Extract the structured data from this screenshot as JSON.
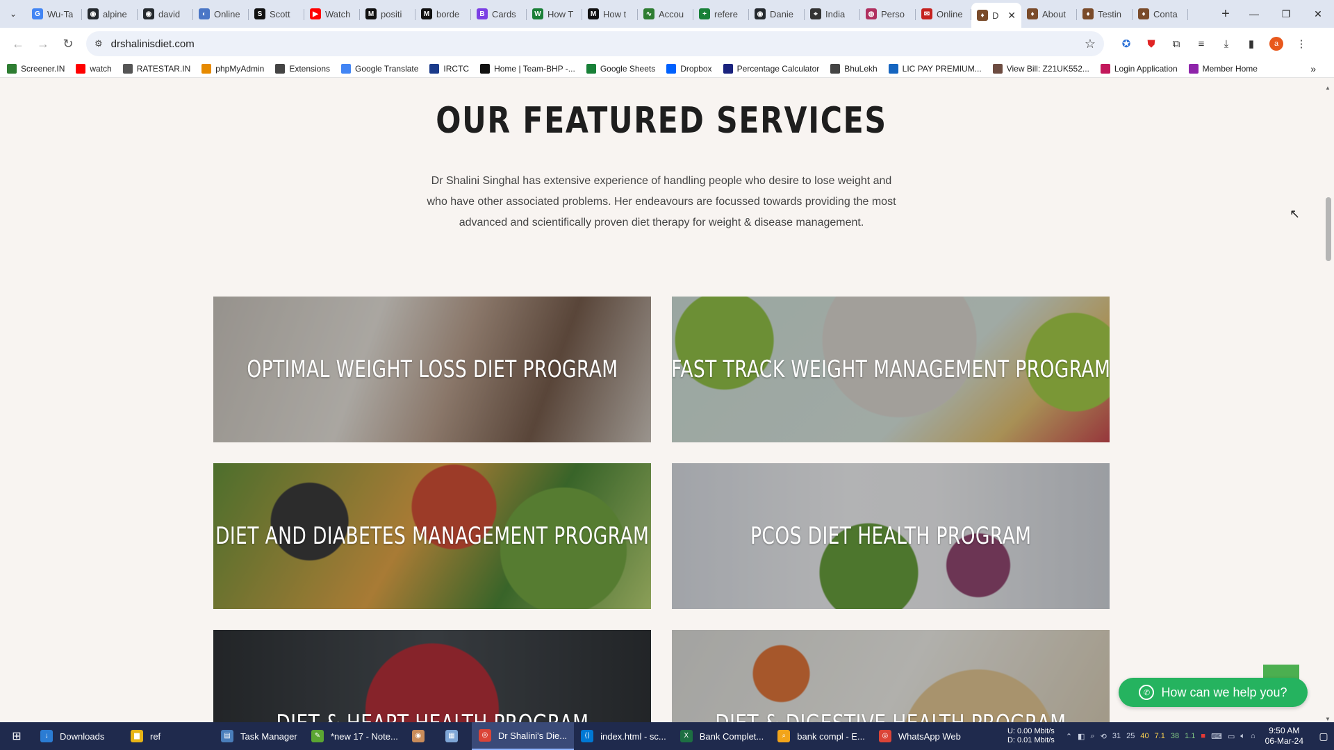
{
  "browser": {
    "tabs": [
      {
        "title": "Wu-Ta",
        "color": "#4285f4",
        "glyph": "G"
      },
      {
        "title": "alpine",
        "color": "#24292e",
        "glyph": "◉"
      },
      {
        "title": "david",
        "color": "#24292e",
        "glyph": "◉"
      },
      {
        "title": "Online",
        "color": "#4a76c6",
        "glyph": "◐"
      },
      {
        "title": "Scott",
        "color": "#111111",
        "glyph": "S"
      },
      {
        "title": "Watch",
        "color": "#ff0000",
        "glyph": "▶"
      },
      {
        "title": "positi",
        "color": "#111111",
        "glyph": "M"
      },
      {
        "title": "borde",
        "color": "#111111",
        "glyph": "M"
      },
      {
        "title": "Cards",
        "color": "#7b3fe4",
        "glyph": "B"
      },
      {
        "title": "How T",
        "color": "#1a7f37",
        "glyph": "W"
      },
      {
        "title": "How t",
        "color": "#111111",
        "glyph": "M"
      },
      {
        "title": "Accou",
        "color": "#2e7d32",
        "glyph": "∿"
      },
      {
        "title": "refere",
        "color": "#188038",
        "glyph": "+"
      },
      {
        "title": "Danie",
        "color": "#24292e",
        "glyph": "◉"
      },
      {
        "title": "India",
        "color": "#333333",
        "glyph": "⌖"
      },
      {
        "title": "Perso",
        "color": "#b03060",
        "glyph": "◍"
      },
      {
        "title": "Online",
        "color": "#c5221f",
        "glyph": "✉"
      },
      {
        "title": "D",
        "color": "#7a4b2a",
        "glyph": "♦",
        "active": true
      },
      {
        "title": "About",
        "color": "#7a4b2a",
        "glyph": "♦"
      },
      {
        "title": "Testin",
        "color": "#7a4b2a",
        "glyph": "♦"
      },
      {
        "title": "Conta",
        "color": "#7a4b2a",
        "glyph": "♦"
      }
    ],
    "url": "drshalinisdiet.com",
    "bookmarks": [
      {
        "label": "Screener.IN",
        "color": "#2e7d32"
      },
      {
        "label": "watch",
        "color": "#ff0000"
      },
      {
        "label": "RATESTAR.IN",
        "color": "#555555"
      },
      {
        "label": "phpMyAdmin",
        "color": "#e68a00"
      },
      {
        "label": "Extensions",
        "color": "#444444"
      },
      {
        "label": "Google Translate",
        "color": "#4285f4"
      },
      {
        "label": "IRCTC",
        "color": "#1a3a8a"
      },
      {
        "label": "Home | Team-BHP -...",
        "color": "#111111"
      },
      {
        "label": "Google Sheets",
        "color": "#188038"
      },
      {
        "label": "Dropbox",
        "color": "#0061fe"
      },
      {
        "label": "Percentage Calculator",
        "color": "#1a237e"
      },
      {
        "label": "BhuLekh",
        "color": "#444444"
      },
      {
        "label": "LIC PAY PREMIUM...",
        "color": "#1565c0"
      },
      {
        "label": "View Bill: Z21UK552...",
        "color": "#6d4c41"
      },
      {
        "label": "Login Application",
        "color": "#c2185b"
      },
      {
        "label": "Member Home",
        "color": "#8e24aa"
      }
    ]
  },
  "page": {
    "heading": "OUR FEATURED SERVICES",
    "intro": "Dr Shalini Singhal has extensive experience of handling people who desire to lose weight and who have other associated problems. Her endeavours are focussed towards providing the most advanced and scientifically proven diet therapy for weight & disease management.",
    "services": [
      {
        "label": "OPTIMAL WEIGHT LOSS DIET PROGRAM"
      },
      {
        "label": "FAST TRACK WEIGHT MANAGEMENT PROGRAM"
      },
      {
        "label": "DIET AND DIABETES MANAGEMENT PROGRAM"
      },
      {
        "label": "PCOS DIET HEALTH PROGRAM"
      },
      {
        "label": "DIET & HEART HEALTH PROGRAM"
      },
      {
        "label": "DIET & DIGESTIVE HEALTH PROGRAM"
      }
    ],
    "help_button": "How can we help you?"
  },
  "taskbar": {
    "items": [
      {
        "label": "Downloads",
        "color": "#2b7cd3",
        "glyph": "↓"
      },
      {
        "label": "ref",
        "color": "#e7b416",
        "glyph": "▆"
      },
      {
        "label": "Task Manager",
        "color": "#4a7ebb",
        "glyph": "▤"
      },
      {
        "label": "*new 17 - Note...",
        "color": "#5ba532",
        "glyph": "✎"
      },
      {
        "label": "",
        "color": "#c98c5a",
        "glyph": "◉"
      },
      {
        "label": "",
        "color": "#7fa6d6",
        "glyph": "▦"
      },
      {
        "label": "Dr Shalini's Die...",
        "color": "#db4437",
        "glyph": "◎",
        "active": true
      },
      {
        "label": "index.html - sc...",
        "color": "#0078d4",
        "glyph": "⟨⟩"
      },
      {
        "label": "Bank Complet...",
        "color": "#1d6f42",
        "glyph": "X"
      },
      {
        "label": "bank compl - E...",
        "color": "#f2a41a",
        "glyph": "⌕"
      },
      {
        "label": "WhatsApp Web",
        "color": "#db4437",
        "glyph": "◎"
      }
    ],
    "net_up": "U:",
    "net_down": "D:",
    "net_up_val": "0.00 Mbit/s",
    "net_down_val": "0.01 Mbit/s",
    "tray_values": [
      "31",
      "25",
      "40",
      "7.1",
      "38",
      "1.1"
    ],
    "time": "9:50 AM",
    "date": "06-Mar-24"
  }
}
